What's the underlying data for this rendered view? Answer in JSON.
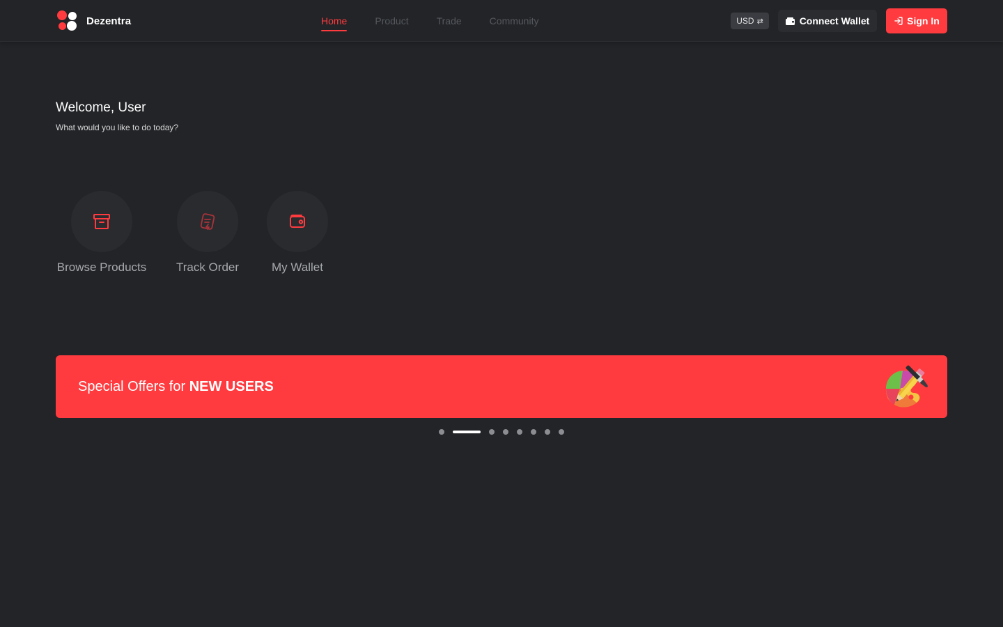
{
  "brand": {
    "name": "Dezentra",
    "accent_color": "#ff3b3f"
  },
  "nav": {
    "items": [
      {
        "label": "Home",
        "active": true
      },
      {
        "label": "Product",
        "active": false
      },
      {
        "label": "Trade",
        "active": false
      },
      {
        "label": "Community",
        "active": false
      }
    ]
  },
  "header": {
    "currency": "USD",
    "currency_icon": "swap-arrows-icon",
    "connect_wallet_label": "Connect Wallet",
    "connect_wallet_icon": "wallet-icon",
    "sign_in_label": "Sign In",
    "sign_in_icon": "sign-in-icon"
  },
  "welcome": {
    "title": "Welcome, User",
    "subtitle": "What would you like to do today?"
  },
  "actions": [
    {
      "label": "Browse Products",
      "icon": "archive-box-icon"
    },
    {
      "label": "Track Order",
      "icon": "track-order-icon"
    },
    {
      "label": "My Wallet",
      "icon": "wallet-icon"
    }
  ],
  "banner": {
    "prefix": "Special Offers for ",
    "highlight": "NEW USERS",
    "art_icon": "paint-palette-brush-icon"
  },
  "carousel": {
    "slide_count": 8,
    "active_index": 1
  }
}
